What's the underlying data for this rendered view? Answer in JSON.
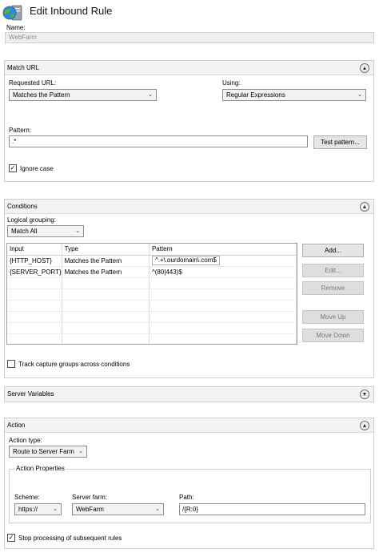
{
  "header": {
    "title": "Edit Inbound Rule",
    "icon": "globe-server-icon"
  },
  "name": {
    "label": "Name:",
    "value": "WebFarm"
  },
  "match_url": {
    "title": "Match URL",
    "requested_url_label": "Requested URL:",
    "requested_url_value": "Matches the Pattern",
    "using_label": "Using:",
    "using_value": "Regular Expressions",
    "pattern_label": "Pattern:",
    "pattern_value": ".*",
    "test_pattern_label": "Test pattern...",
    "ignore_case_label": "Ignore case",
    "ignore_case_checked": true
  },
  "conditions": {
    "title": "Conditions",
    "logical_grouping_label": "Logical grouping:",
    "logical_grouping_value": "Match All",
    "columns": [
      "Input",
      "Type",
      "Pattern"
    ],
    "rows": [
      {
        "input": "{HTTP_HOST}",
        "type": "Matches the Pattern",
        "pattern": "^.+\\.ourdomain\\.com$"
      },
      {
        "input": "{SERVER_PORT}",
        "type": "Matches the Pattern",
        "pattern": "^(80|443)$"
      }
    ],
    "buttons": {
      "add": "Add...",
      "edit": "Edit...",
      "remove": "Remove",
      "move_up": "Move Up",
      "move_down": "Move Down"
    },
    "track_label": "Track capture groups across conditions",
    "track_checked": false
  },
  "server_variables": {
    "title": "Server Variables"
  },
  "action": {
    "title": "Action",
    "action_type_label": "Action type:",
    "action_type_value": "Route to Server Farm",
    "properties_title": "Action Properties",
    "scheme_label": "Scheme:",
    "scheme_value": "https://",
    "server_farm_label": "Server farm:",
    "server_farm_value": "WebFarm",
    "path_label": "Path:",
    "path_value": "/{R:0}",
    "stop_label": "Stop processing of subsequent rules",
    "stop_checked": true
  },
  "icons": {
    "collapse": "chevron-up-icon",
    "expand": "chevron-down-icon"
  }
}
